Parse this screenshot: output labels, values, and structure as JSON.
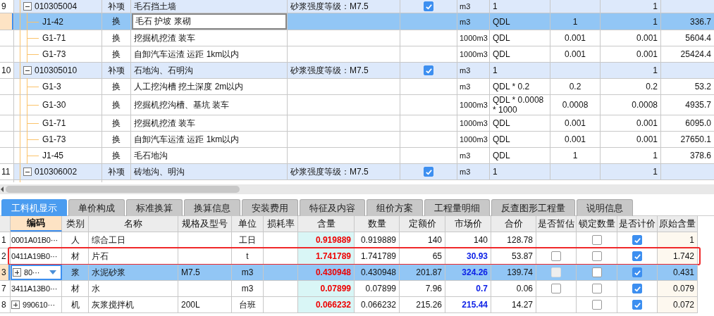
{
  "top_rows": [
    {
      "kind": "item",
      "row_no": "9",
      "code": "010305004",
      "expanded": true,
      "type": "补项",
      "name": "毛石挡土墙",
      "feature": "砂浆强度等级：M7.5",
      "priced": true,
      "unit": "m3",
      "expr": "1",
      "col_2": "1",
      "selected": false
    },
    {
      "kind": "sub",
      "code": "J1-42",
      "type": "换",
      "name": "毛石 护坡 浆砌",
      "unit": "m3",
      "expr": "QDL",
      "col_1": "1",
      "col_2": "1",
      "col_3": "336.7",
      "selected": true
    },
    {
      "kind": "sub",
      "code": "G1-71",
      "type": "换",
      "name": "挖掘机挖渣 装车",
      "unit": "1000m3",
      "expr": "QDL",
      "col_1": "0.001",
      "col_2": "0.001",
      "col_3": "5604.4",
      "selected": false
    },
    {
      "kind": "sub",
      "code": "G1-73",
      "type": "换",
      "name": "自卸汽车运渣 运距 1km以内",
      "unit": "1000m3",
      "expr": "QDL",
      "col_1": "0.001",
      "col_2": "0.001",
      "col_3": "25424.4",
      "selected": false
    },
    {
      "kind": "item",
      "row_no": "10",
      "code": "010305010",
      "expanded": true,
      "type": "补项",
      "name": "石地沟、石明沟",
      "feature": "砂浆强度等级：M7.5",
      "priced": true,
      "unit": "m3",
      "expr": "1",
      "col_2": "1",
      "selected": false
    },
    {
      "kind": "sub",
      "code": "G1-3",
      "type": "换",
      "name": "人工挖沟槽 挖土深度 2m以内",
      "unit": "m3",
      "expr": "QDL * 0.2",
      "col_1": "0.2",
      "col_2": "0.2",
      "col_3": "53.2",
      "selected": false
    },
    {
      "kind": "sub",
      "code": "G1-30",
      "type": "换",
      "name": "挖掘机挖沟槽、基坑 装车",
      "unit": "1000m3",
      "expr": "QDL * 0.0008 * 1000",
      "col_1": "0.0008",
      "col_2": "0.0008",
      "col_3": "4935.7",
      "selected": false
    },
    {
      "kind": "sub",
      "code": "G1-71",
      "type": "换",
      "name": "挖掘机挖渣 装车",
      "unit": "1000m3",
      "expr": "QDL",
      "col_1": "0.001",
      "col_2": "0.001",
      "col_3": "6095.0",
      "selected": false
    },
    {
      "kind": "sub",
      "code": "G1-73",
      "type": "换",
      "name": "自卸汽车运渣 运距 1km以内",
      "unit": "1000m3",
      "expr": "QDL",
      "col_1": "0.001",
      "col_2": "0.001",
      "col_3": "27650.1",
      "selected": false
    },
    {
      "kind": "sub",
      "code": "J1-45",
      "type": "换",
      "name": "毛石地沟",
      "unit": "m3",
      "expr": "QDL",
      "col_1": "1",
      "col_2": "1",
      "col_3": "378.6",
      "selected": false
    },
    {
      "kind": "item",
      "row_no": "11",
      "code": "010306002",
      "expanded": true,
      "type": "补项",
      "name": "砖地沟、明沟",
      "feature": "砂浆强度等级：M7.5",
      "priced": true,
      "unit": "m3",
      "expr": "1",
      "col_2": "1",
      "selected": false
    }
  ],
  "tabs": [
    {
      "label": "工料机显示",
      "selected": true
    },
    {
      "label": "单价构成",
      "selected": false
    },
    {
      "label": "标准换算",
      "selected": false
    },
    {
      "label": "换算信息",
      "selected": false
    },
    {
      "label": "安装费用",
      "selected": false
    },
    {
      "label": "特征及内容",
      "selected": false
    },
    {
      "label": "组价方案",
      "selected": false
    },
    {
      "label": "工程量明细",
      "selected": false
    },
    {
      "label": "反查图形工程量",
      "selected": false
    },
    {
      "label": "说明信息",
      "selected": false
    }
  ],
  "columns": [
    "编码",
    "类别",
    "名称",
    "规格及型号",
    "单位",
    "损耗率",
    "含量",
    "数量",
    "定额价",
    "市场价",
    "合价",
    "是否暂估",
    "锁定数量",
    "是否计价",
    "原始含量"
  ],
  "rows": [
    {
      "row_no": "1",
      "code": "0001A01B0···",
      "expandable": false,
      "type": "人",
      "name": "综合工日",
      "unit": "工日",
      "content": "0.919889",
      "qty": "0.919889",
      "quota": "140",
      "market": "140",
      "market_changed": false,
      "total": "128.78",
      "locked": false,
      "priced": true,
      "original": "1",
      "selected": false,
      "highlighted": false
    },
    {
      "row_no": "2",
      "code": "0411A19B0···",
      "expandable": false,
      "type": "材",
      "name": "片石",
      "unit": "t",
      "content": "1.741789",
      "qty": "1.741789",
      "quota": "65",
      "market": "30.93",
      "market_changed": true,
      "total": "53.87",
      "estimate": {
        "checked": false,
        "disabled": false
      },
      "locked": false,
      "priced": true,
      "original": "1.742",
      "selected": false,
      "highlighted": true
    },
    {
      "row_no": "3",
      "code": "80···",
      "expandable": true,
      "type": "浆",
      "name": "水泥砂浆",
      "spec": "M7.5",
      "unit": "m3",
      "content": "0.430948",
      "qty": "0.430948",
      "quota": "201.87",
      "market": "324.26",
      "market_changed": true,
      "total": "139.74",
      "estimate": {
        "checked": false,
        "disabled": true
      },
      "locked": false,
      "priced": true,
      "original": "0.431",
      "selected": true,
      "highlighted": false
    },
    {
      "row_no": "7",
      "code": "3411A13B0···",
      "expandable": false,
      "type": "材",
      "name": "水",
      "unit": "m3",
      "content": "0.07899",
      "qty": "0.07899",
      "quota": "7.96",
      "market": "0.7",
      "market_changed": true,
      "total": "0.06",
      "estimate": {
        "checked": false,
        "disabled": false
      },
      "locked": false,
      "priced": true,
      "original": "0.079",
      "selected": false,
      "highlighted": false
    },
    {
      "row_no": "8",
      "code": "990610···",
      "expandable": true,
      "type": "机",
      "name": "灰浆搅拌机",
      "spec": "200L",
      "unit": "台班",
      "content": "0.066232",
      "qty": "0.066232",
      "quota": "215.26",
      "market": "215.44",
      "market_changed": true,
      "total": "14.27",
      "locked": false,
      "priced": true,
      "original": "0.072",
      "selected": false,
      "highlighted": false
    }
  ]
}
